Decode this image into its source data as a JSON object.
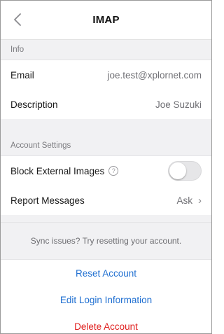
{
  "header": {
    "title": "IMAP",
    "back_icon": "chevron-left-icon"
  },
  "info": {
    "section_title": "Info",
    "email": {
      "label": "Email",
      "value": "joe.test@xplornet.com"
    },
    "description": {
      "label": "Description",
      "value": "Joe Suzuki"
    }
  },
  "account_settings": {
    "section_title": "Account Settings",
    "block_external_images": {
      "label": "Block External Images",
      "help_glyph": "?",
      "enabled": false
    },
    "report_messages": {
      "label": "Report Messages",
      "value": "Ask",
      "chevron": "›"
    }
  },
  "note": "Sync issues? Try resetting your account.",
  "actions": {
    "reset": "Reset Account",
    "edit_login": "Edit Login Information",
    "delete": "Delete Account"
  },
  "colors": {
    "link_blue": "#1f6fd1",
    "destructive_red": "#e0201f",
    "group_bg": "#f1f1f3"
  }
}
